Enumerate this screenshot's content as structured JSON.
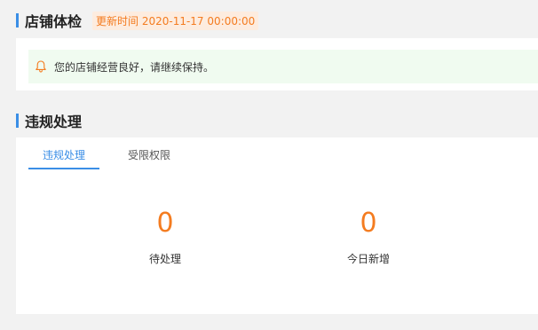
{
  "shop_check": {
    "title": "店铺体检",
    "update_text": "更新时间 2020-11-17 00:00:00",
    "notice_text": "您的店铺经营良好，请继续保持。"
  },
  "violations": {
    "title": "违规处理",
    "tabs": [
      {
        "label": "违规处理",
        "active": true
      },
      {
        "label": "受限权限",
        "active": false
      }
    ],
    "stats": [
      {
        "value": "0",
        "label": "待处理"
      },
      {
        "value": "0",
        "label": "今日新增"
      }
    ]
  },
  "colors": {
    "accent": "#3a8ee6",
    "highlight": "#f47c20",
    "notice_bg": "#f0fbf0"
  },
  "icons": {
    "notice": "bell-icon"
  }
}
